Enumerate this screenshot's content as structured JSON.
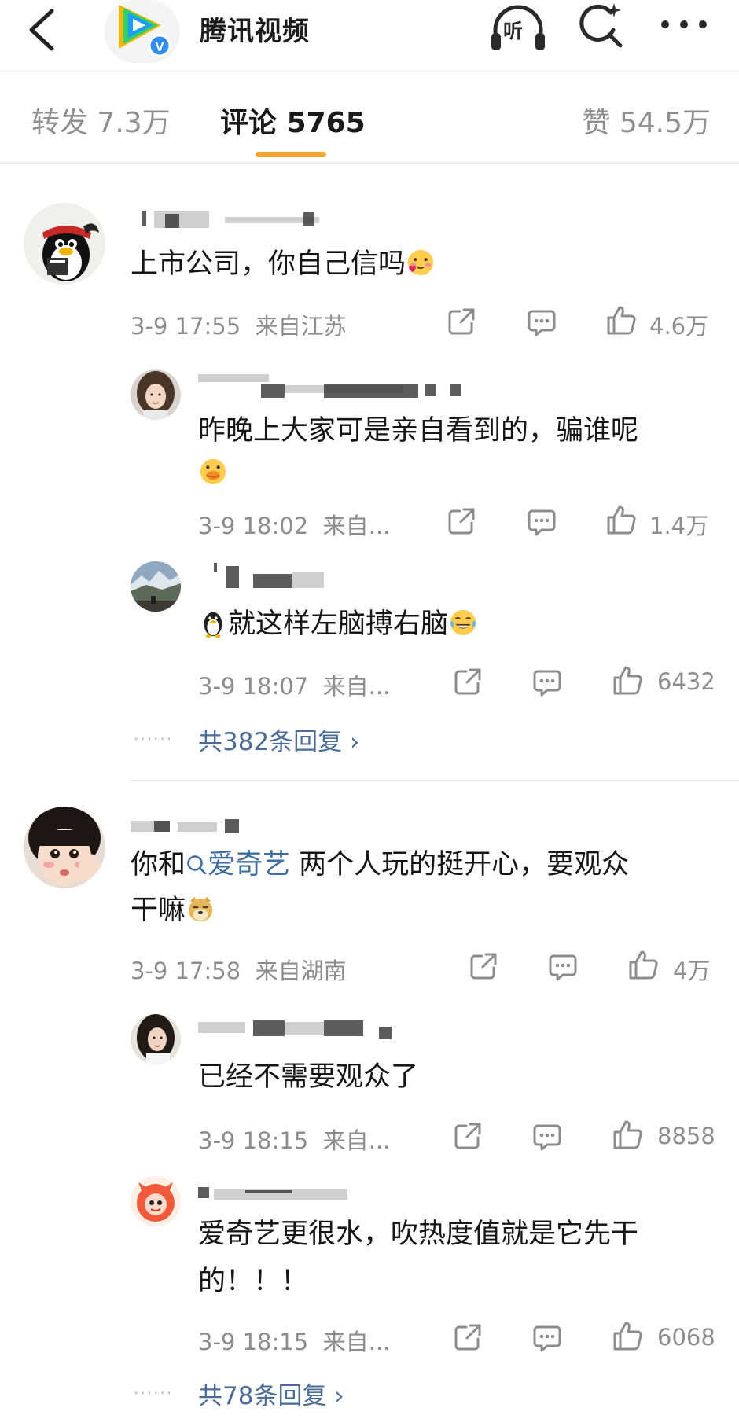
{
  "header": {
    "title": "腾讯视频",
    "listen_label": "听",
    "verified_badge": "V",
    "icons": [
      "back-icon",
      "tencent-video-logo",
      "headphones-icon",
      "search-icon",
      "more-icon"
    ]
  },
  "tabs": {
    "repost": "转发 7.3万",
    "comments": "评论 5765",
    "likes": "赞 54.5万",
    "active": "comments",
    "accent_color": "#f5a623"
  },
  "threads": [
    {
      "comment": {
        "text": "上市公司，你自己信吗",
        "emoji": "blush-heart-emoji",
        "time": "3-9 17:55",
        "location": "来自江苏",
        "likes": "4.6万"
      },
      "replies": [
        {
          "line1": "昨晚上大家可是亲自看到的，骗谁呢",
          "emoji": "duck-emoji",
          "time": "3-9 18:02",
          "location": "来自...",
          "likes": "1.4万"
        },
        {
          "text": "就这样左脑搏右脑",
          "lead_emoji": "penguin-emoji",
          "emoji": "laughing-tears-emoji",
          "time": "3-9 18:07",
          "location": "来自...",
          "likes": "6432"
        }
      ],
      "more_replies": "共382条回复 ›"
    },
    {
      "comment": {
        "prefix": "你和",
        "link": "爱奇艺",
        "suffix": " 两个人玩的挺开心，要观众",
        "line2": "干嘛",
        "emoji": "doge-emoji",
        "time": "3-9 17:58",
        "location": "来自湖南",
        "likes": "4万"
      },
      "replies": [
        {
          "text": "已经不需要观众了",
          "time": "3-9 18:15",
          "location": "来自...",
          "likes": "8858"
        },
        {
          "line1": "爱奇艺更很水，吹热度值就是它先干",
          "line2": "的！！！",
          "time": "3-9 18:15",
          "location": "来自...",
          "likes": "6068"
        }
      ],
      "more_replies": "共78条回复 ›"
    }
  ],
  "leader_dots": "······",
  "colors": {
    "link": "#3f6ea3",
    "meta": "#8d8d8d",
    "more_replies": "#4a6c98"
  }
}
